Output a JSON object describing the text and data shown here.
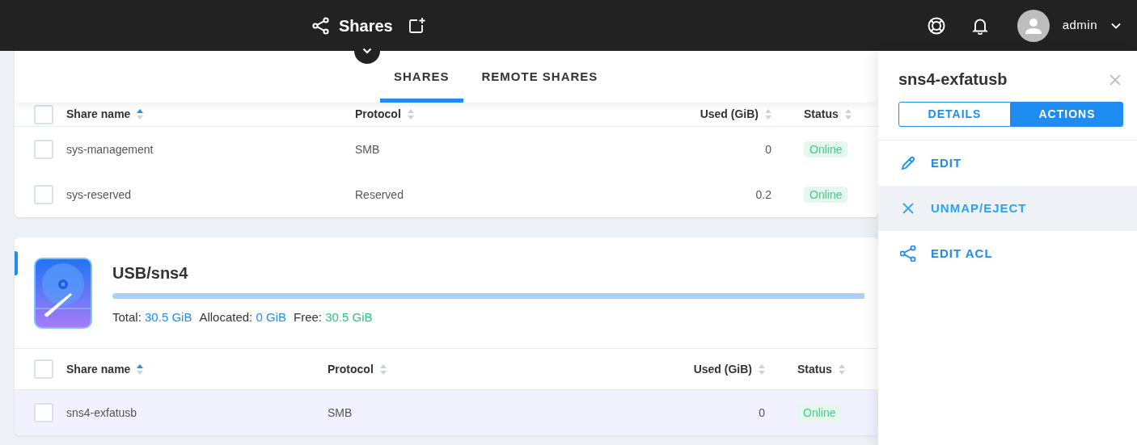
{
  "topbar": {
    "title": "Shares",
    "user": "admin"
  },
  "tabs": [
    {
      "label": "SHARES",
      "selected": true
    },
    {
      "label": "REMOTE SHARES",
      "selected": false
    }
  ],
  "tables": [
    {
      "all_checked": false,
      "columns": [
        {
          "label": "Share name",
          "sorted": true
        },
        {
          "label": "Protocol",
          "sorted": false
        },
        {
          "label": "Used (GiB)",
          "sorted": false
        },
        {
          "label": "Status",
          "sorted": false
        }
      ],
      "rows": [
        {
          "name": "sys-management",
          "protocol": "SMB",
          "used": "0",
          "status": "Online",
          "checked": false,
          "selected": false
        },
        {
          "name": "sys-reserved",
          "protocol": "Reserved",
          "used": "0.2",
          "status": "Online",
          "checked": false,
          "selected": false
        }
      ]
    },
    {
      "title": "USB/sns4",
      "all_checked": false,
      "stats": [
        {
          "label": "Total:",
          "value": "30.5 GiB",
          "color": "#1e8cf0"
        },
        {
          "label": "Allocated:",
          "value": "0 GiB",
          "color": "#1e8cf0"
        },
        {
          "label": "Free:",
          "value": "30.5 GiB",
          "color": "#2ec27e"
        }
      ],
      "columns": [
        {
          "label": "Share name",
          "sorted": true
        },
        {
          "label": "Protocol",
          "sorted": false
        },
        {
          "label": "Used (GiB)",
          "sorted": false
        },
        {
          "label": "Status",
          "sorted": false
        }
      ],
      "rows": [
        {
          "name": "sns4-exfatusb",
          "protocol": "SMB",
          "used": "0",
          "status": "Online",
          "checked": false,
          "selected": true
        }
      ]
    }
  ],
  "panel": {
    "title": "sns4-exfatusb",
    "toggle": [
      {
        "label": "DETAILS",
        "selected": false
      },
      {
        "label": "ACTIONS",
        "selected": true
      }
    ],
    "actions": [
      {
        "label": "EDIT",
        "kind": "edit",
        "highlighted": false
      },
      {
        "label": "UNMAP/EJECT",
        "kind": "remove",
        "highlighted": true
      },
      {
        "label": "EDIT ACL",
        "kind": "share",
        "highlighted": false
      }
    ]
  }
}
